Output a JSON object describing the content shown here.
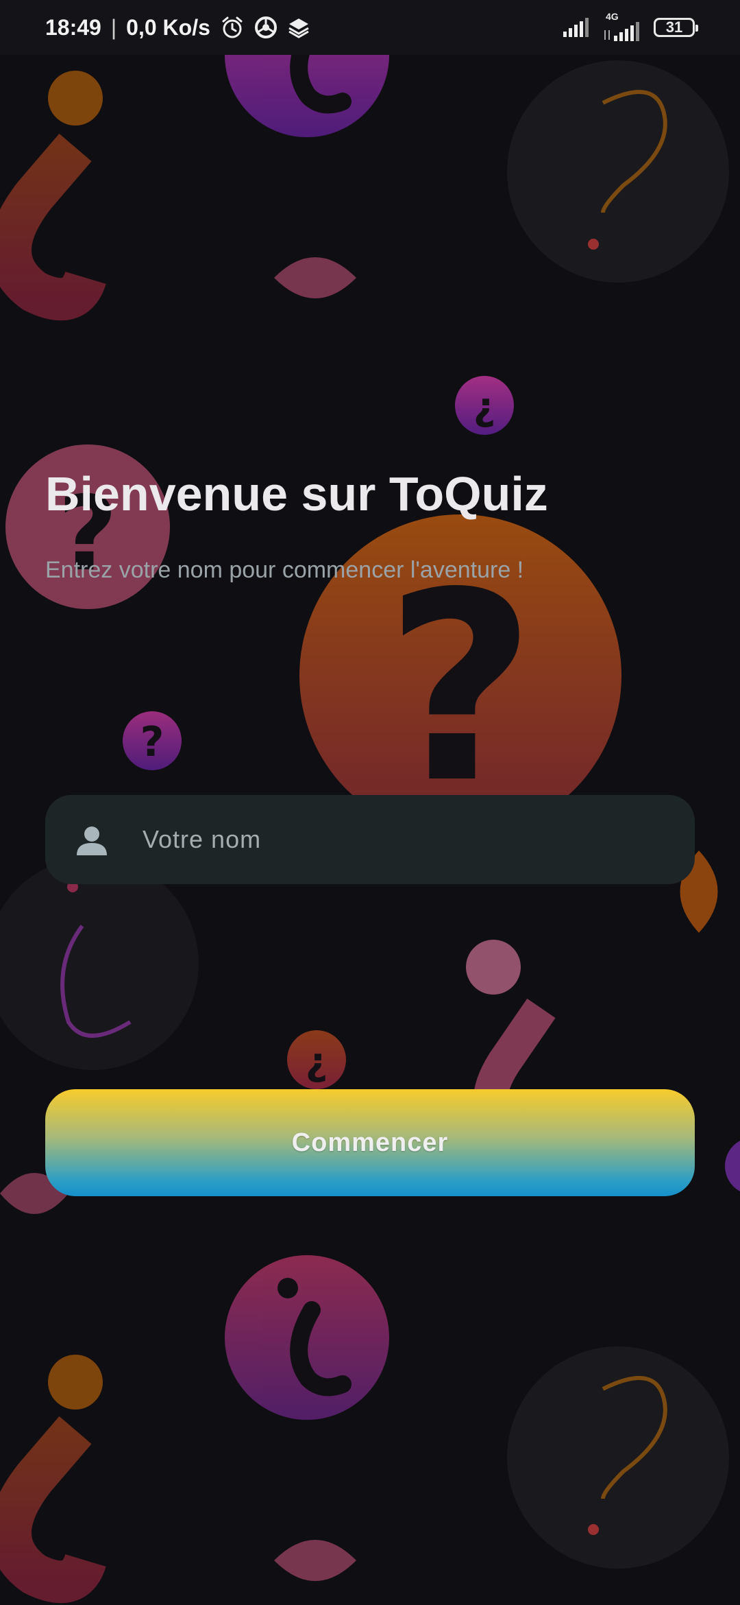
{
  "status_bar": {
    "time": "18:49",
    "separator": "|",
    "net_speed": "0,0 Ko/s",
    "network_type": "4G",
    "battery_level": "31",
    "icons": [
      "alarm-icon",
      "chrome-icon",
      "layers-icon",
      "signal-icon",
      "signal-4g-icon",
      "battery-icon"
    ]
  },
  "welcome": {
    "title": "Bienvenue sur ToQuiz",
    "subtitle": "Entrez votre nom pour commencer l'aventure !"
  },
  "name_field": {
    "placeholder": "Votre nom",
    "value": "",
    "icon": "person-icon"
  },
  "start_button": {
    "label": "Commencer"
  },
  "colors": {
    "background": "#0f0e12",
    "field_background": "#1d2526",
    "button_gradient_top": "#f7cb2c",
    "button_gradient_bottom": "#1590cc",
    "accent_orange": "#e07a1f",
    "accent_purple": "#7b2fb0",
    "accent_pink": "#c8507a"
  }
}
